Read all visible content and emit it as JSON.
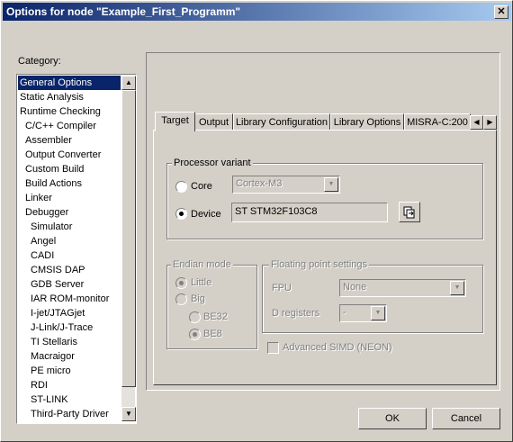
{
  "window": {
    "title": "Options for node \"Example_First_Programm\"",
    "close_glyph": "✕"
  },
  "category": {
    "label": "Category:",
    "items": [
      "General Options",
      "Static Analysis",
      "Runtime Checking",
      "C/C++ Compiler",
      "Assembler",
      "Output Converter",
      "Custom Build",
      "Build Actions",
      "Linker",
      "Debugger",
      "Simulator",
      "Angel",
      "CADI",
      "CMSIS DAP",
      "GDB Server",
      "IAR ROM-monitor",
      "I-jet/JTAGjet",
      "J-Link/J-Trace",
      "TI Stellaris",
      "Macraigor",
      "PE micro",
      "RDI",
      "ST-LINK",
      "Third-Party Driver"
    ],
    "selected": "General Options"
  },
  "tabs": [
    "Target",
    "Output",
    "Library Configuration",
    "Library Options",
    "MISRA-C:200"
  ],
  "tab_scroll": {
    "left": "◀",
    "right": "▶"
  },
  "processor": {
    "group_label": "Processor variant",
    "core_label": "Core",
    "core_value": "Cortex-M3",
    "device_label": "Device",
    "device_value": "ST STM32F103C8",
    "selected": "Device"
  },
  "endian": {
    "group_label": "Endian mode",
    "little": "Little",
    "big": "Big",
    "be32": "BE32",
    "be8": "BE8"
  },
  "fp": {
    "group_label": "Floating point settings",
    "fpu_label": "FPU",
    "fpu_value": "None",
    "dreg_label": "D registers",
    "dreg_value": "-",
    "simd_label": "Advanced SIMD (NEON)"
  },
  "buttons": {
    "ok": "OK",
    "cancel": "Cancel"
  }
}
